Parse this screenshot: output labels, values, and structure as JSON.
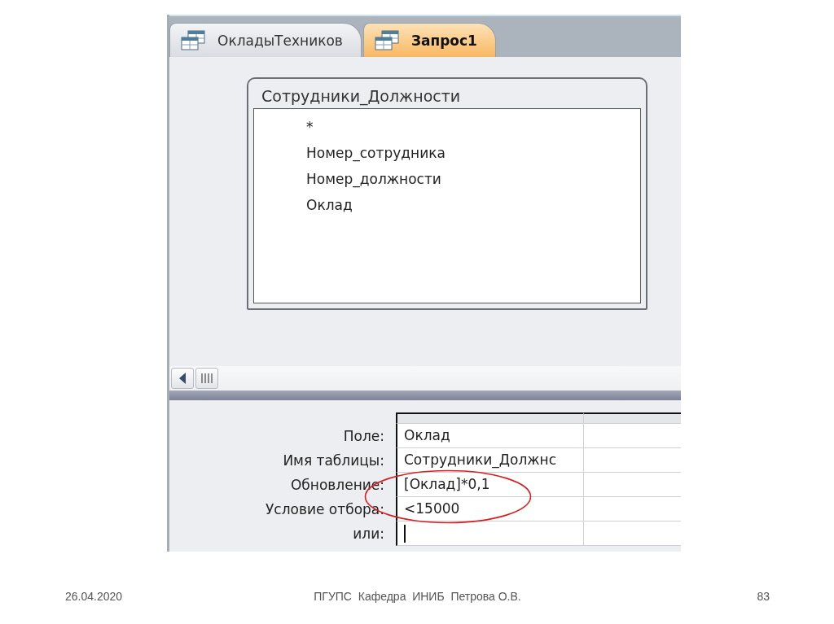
{
  "tabs": [
    {
      "label": "ОкладыТехников",
      "selected": false
    },
    {
      "label": "Запрос1",
      "selected": true
    }
  ],
  "table": {
    "title": "Сотрудники_Должности",
    "fields": [
      "*",
      "Номер_сотрудника",
      "Номер_должности",
      "Оклад"
    ]
  },
  "grid": {
    "rows": [
      {
        "label": "Поле:",
        "value": "Оклад",
        "editing": false
      },
      {
        "label": "Имя таблицы:",
        "value": "Сотрудники_Должнс",
        "editing": false
      },
      {
        "label": "Обновление:",
        "value": "[Оклад]*0,1",
        "editing": false
      },
      {
        "label": "Условие отбора:",
        "value": "<15000",
        "editing": false
      },
      {
        "label": "или:",
        "editing": true
      }
    ]
  },
  "annotations": [
    {
      "kind": "ellipse"
    }
  ],
  "footer": {
    "date": "26.04.2020",
    "center": "ПГУПС  Кафедра  ИНИБ  Петрова О.В.",
    "page": "83"
  }
}
